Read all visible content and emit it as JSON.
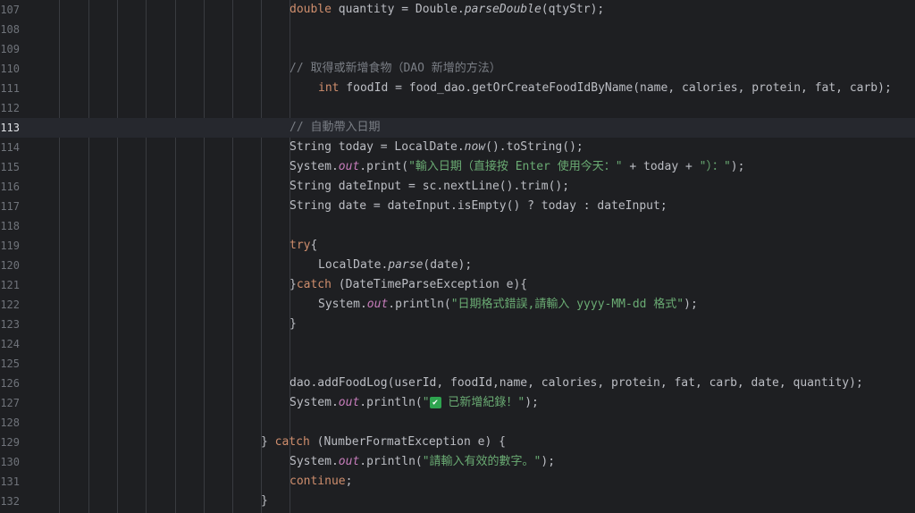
{
  "editor": {
    "current_line": "113",
    "lines": [
      {
        "n": "107",
        "indent": 324,
        "tokens": [
          {
            "c": "kw",
            "t": "double"
          },
          {
            "c": "",
            "t": " quantity = Double."
          },
          {
            "c": "it",
            "t": "parseDouble"
          },
          {
            "c": "",
            "t": "(qtyStr);"
          }
        ]
      },
      {
        "n": "108",
        "indent": 324,
        "tokens": []
      },
      {
        "n": "109",
        "indent": 324,
        "tokens": []
      },
      {
        "n": "110",
        "indent": 324,
        "tokens": [
          {
            "c": "cmt",
            "t": "// 取得或新增食物（DAO 新增的方法）"
          }
        ]
      },
      {
        "n": "111",
        "indent": 356,
        "tokens": [
          {
            "c": "kw",
            "t": "int"
          },
          {
            "c": "",
            "t": " foodId = food_dao.getOrCreateFoodIdByName(name, calories, protein, fat, carb);"
          }
        ]
      },
      {
        "n": "112",
        "indent": 324,
        "tokens": []
      },
      {
        "n": "113",
        "indent": 324,
        "tokens": [
          {
            "c": "cmt",
            "t": "// 自動帶入日期"
          }
        ]
      },
      {
        "n": "114",
        "indent": 324,
        "tokens": [
          {
            "c": "",
            "t": "String today = LocalDate."
          },
          {
            "c": "it",
            "t": "now"
          },
          {
            "c": "",
            "t": "().toString();"
          }
        ]
      },
      {
        "n": "115",
        "indent": 324,
        "tokens": [
          {
            "c": "",
            "t": "System."
          },
          {
            "c": "fld",
            "t": "out"
          },
          {
            "c": "",
            "t": ".print("
          },
          {
            "c": "str",
            "t": "\"輸入日期（直接按 Enter 使用今天：\""
          },
          {
            "c": "",
            "t": " + today + "
          },
          {
            "c": "str",
            "t": "\"）：\""
          },
          {
            "c": "",
            "t": ");"
          }
        ]
      },
      {
        "n": "116",
        "indent": 324,
        "tokens": [
          {
            "c": "",
            "t": "String dateInput = sc.nextLine().trim();"
          }
        ]
      },
      {
        "n": "117",
        "indent": 324,
        "tokens": [
          {
            "c": "",
            "t": "String date = dateInput.isEmpty() ? today : dateInput;"
          }
        ]
      },
      {
        "n": "118",
        "indent": 324,
        "tokens": []
      },
      {
        "n": "119",
        "indent": 324,
        "tokens": [
          {
            "c": "kw",
            "t": "try"
          },
          {
            "c": "",
            "t": "{"
          }
        ]
      },
      {
        "n": "120",
        "indent": 356,
        "tokens": [
          {
            "c": "",
            "t": "LocalDate."
          },
          {
            "c": "it",
            "t": "parse"
          },
          {
            "c": "",
            "t": "(date);"
          }
        ]
      },
      {
        "n": "121",
        "indent": 324,
        "tokens": [
          {
            "c": "",
            "t": "}"
          },
          {
            "c": "kw",
            "t": "catch"
          },
          {
            "c": "",
            "t": " (DateTimeParseException e){"
          }
        ]
      },
      {
        "n": "122",
        "indent": 356,
        "tokens": [
          {
            "c": "",
            "t": "System."
          },
          {
            "c": "fld",
            "t": "out"
          },
          {
            "c": "",
            "t": ".println("
          },
          {
            "c": "str",
            "t": "\"日期格式錯誤,請輸入 yyyy-MM-dd 格式\""
          },
          {
            "c": "",
            "t": ");"
          }
        ]
      },
      {
        "n": "123",
        "indent": 324,
        "tokens": [
          {
            "c": "",
            "t": "}"
          }
        ]
      },
      {
        "n": "124",
        "indent": 324,
        "tokens": []
      },
      {
        "n": "125",
        "indent": 324,
        "tokens": []
      },
      {
        "n": "126",
        "indent": 324,
        "tokens": [
          {
            "c": "",
            "t": "dao.addFoodLog(userId, foodId,name, calories, protein, fat, carb, date, quantity);"
          }
        ]
      },
      {
        "n": "127",
        "indent": 324,
        "tokens": [
          {
            "c": "",
            "t": "System."
          },
          {
            "c": "fld",
            "t": "out"
          },
          {
            "c": "",
            "t": ".println("
          },
          {
            "c": "str",
            "t": "\""
          },
          {
            "c": "check",
            "t": "✔"
          },
          {
            "c": "str",
            "t": " 已新增紀錄！\""
          },
          {
            "c": "",
            "t": ");"
          }
        ]
      },
      {
        "n": "128",
        "indent": 324,
        "tokens": []
      },
      {
        "n": "129",
        "indent": 292,
        "tokens": [
          {
            "c": "",
            "t": "} "
          },
          {
            "c": "kw",
            "t": "catch"
          },
          {
            "c": "",
            "t": " (NumberFormatException e) {"
          }
        ]
      },
      {
        "n": "130",
        "indent": 324,
        "tokens": [
          {
            "c": "",
            "t": "System."
          },
          {
            "c": "fld",
            "t": "out"
          },
          {
            "c": "",
            "t": ".println("
          },
          {
            "c": "str",
            "t": "\"請輸入有效的數字。\""
          },
          {
            "c": "",
            "t": ");"
          }
        ]
      },
      {
        "n": "131",
        "indent": 324,
        "tokens": [
          {
            "c": "kw",
            "t": "continue"
          },
          {
            "c": "",
            "t": ";"
          }
        ]
      },
      {
        "n": "132",
        "indent": 292,
        "tokens": [
          {
            "c": "",
            "t": "}"
          }
        ]
      }
    ]
  }
}
